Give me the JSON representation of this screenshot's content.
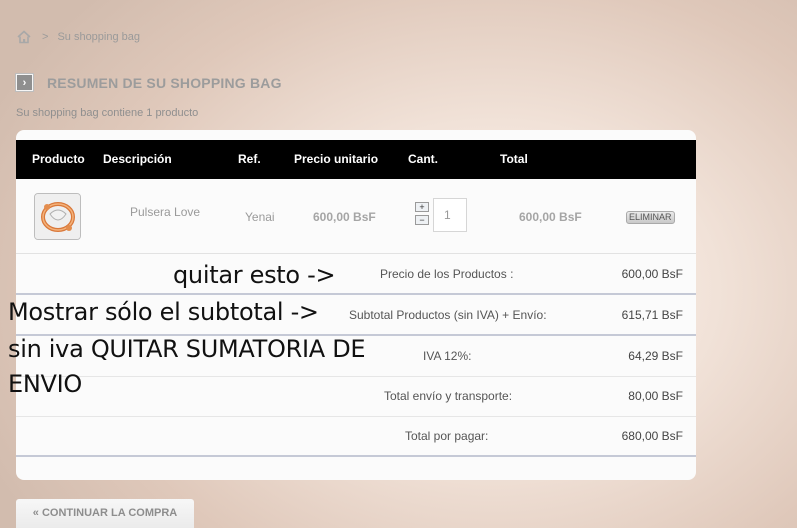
{
  "breadcrumb": {
    "home_icon": "home-icon",
    "separator": ">",
    "current": "Su shopping bag"
  },
  "heading": {
    "icon": "arrow-right-icon",
    "title": "RESUMEN DE SU SHOPPING BAG"
  },
  "bag_count": "Su shopping bag contiene 1 producto",
  "table": {
    "headers": [
      "Producto",
      "Descripción",
      "Ref.",
      "Precio unitario",
      "Cant.",
      "Total"
    ],
    "row": {
      "image_icon": "bracelet-thumbnail",
      "description": "Pulsera Love",
      "ref": "Yenai",
      "unit_price": "600,00 BsF",
      "qty_plus": "+",
      "qty_minus": "−",
      "quantity": "1",
      "total": "600,00 BsF",
      "delete_label": "ELIMINAR"
    }
  },
  "summary": [
    {
      "label": "Precio de los Productos :",
      "value": "600,00 BsF"
    },
    {
      "label": "Subtotal Productos (sin IVA) + Envío:",
      "value": "615,71 BsF"
    },
    {
      "label": "IVA 12%:",
      "value": "64,29 BsF"
    },
    {
      "label": "Total envío y transporte:",
      "value": "80,00 BsF"
    },
    {
      "label": "Total por pagar:",
      "value": "680,00 BsF"
    }
  ],
  "annotations": {
    "note1": "quitar esto ->",
    "note2_line1": "Mostrar sólo el subtotal ->",
    "note2_line2": "sin iva  QUITAR SUMATORIA DE",
    "note2_line3": "ENVIO"
  },
  "continue_label": "« CONTINUAR LA COMPRA"
}
